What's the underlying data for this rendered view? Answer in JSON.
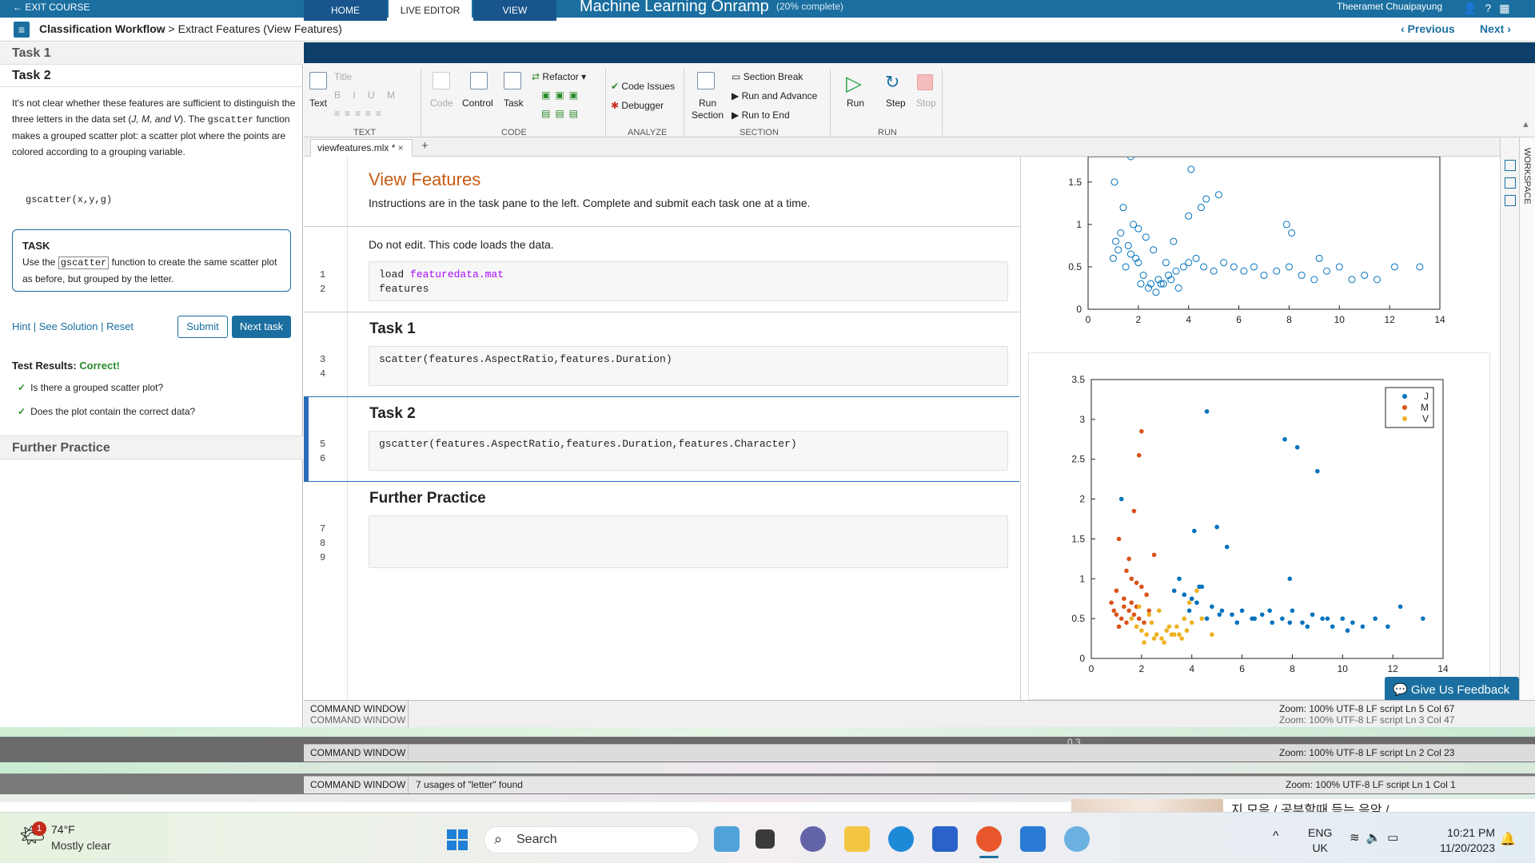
{
  "topbar": {
    "exit": "← EXIT COURSE",
    "title": "Machine Learning Onramp",
    "progress": "(20% complete)",
    "user": "Theeramet Chuaipayung"
  },
  "nav": {
    "breadcrumb_bold": "Classification Workflow",
    "breadcrumb_rest": " > Extract Features (View Features)",
    "previous": "‹ Previous",
    "next": "Next ›"
  },
  "taskpane": {
    "task1": "Task 1",
    "task2": "Task 2",
    "desc1": "It's not clear whether these features are sufficient to distinguish the three letters in the data set (",
    "desc_letters": "J, M, and V",
    "desc2": "). The ",
    "desc_fn": "gscatter",
    "desc3": " function makes a grouped scatter plot: a scatter plot where the points are colored according to a grouping variable.",
    "syntax": "gscatter(x,y,g)",
    "task_label": "TASK",
    "task_text1": "Use the ",
    "task_kw": "gscatter",
    "task_text2": " function to create the same scatter plot as before, but grouped by the letter.",
    "hint": "Hint",
    "see_solution": "See Solution",
    "reset": "Reset",
    "submit": "Submit",
    "next_task": "Next task",
    "test_results_label": "Test Results:",
    "test_results_value": "Correct!",
    "checks": [
      "Is there a grouped scatter plot?",
      "Does the plot contain the correct data?"
    ],
    "further": "Further Practice"
  },
  "ribbon": {
    "tabs": [
      "HOME",
      "LIVE EDITOR",
      "VIEW"
    ],
    "text_btn": "Text",
    "title_btn": "Title",
    "code_btn": "Code",
    "control_btn": "Control",
    "task_btn": "Task",
    "refactor": "Refactor",
    "code_issues": "Code Issues",
    "debugger": "Debugger",
    "run_section": "Run\nSection",
    "section_break": "Section Break",
    "run_advance": "Run and Advance",
    "run_end": "Run to End",
    "run": "Run",
    "step": "Step",
    "stop": "Stop",
    "sections": [
      "TEXT",
      "CODE",
      "ANALYZE",
      "SECTION",
      "RUN"
    ]
  },
  "editor": {
    "tab": "viewfeatures.mlx *",
    "title": "View Features",
    "subtitle": "Instructions are in the task pane to the left. Complete and submit each task one at a time.",
    "noedit": "Do not edit. This code loads the data.",
    "code_load_kw": "load ",
    "code_load_str": "featuredata.mat",
    "code_features": "features",
    "task1": "Task 1",
    "code_task1": "scatter(features.AspectRatio,features.Duration)",
    "task2": "Task 2",
    "code_task2": "gscatter(features.AspectRatio,features.Duration,features.Character)",
    "further": "Further Practice",
    "line_numbers": [
      "1",
      "2",
      "3",
      "4",
      "5",
      "6",
      "7",
      "8",
      "9"
    ]
  },
  "workspace_label": "WORKSPACE",
  "command": {
    "label": "COMMAND WINDOW",
    "usages": "7 usages of \"letter\" found",
    "status1": "Zoom: 100%   UTF-8   LF   script   Ln  5  Col  67",
    "status2": "Zoom: 100%   UTF-8   LF   script   Ln  3  Col  47",
    "status3": "Zoom: 100%   UTF-8   LF   script   Ln  2  Col  23",
    "status4": "Zoom: 100%   UTF-8   LF   script   Ln  1  Col  1",
    "glitch_axis": "0.3"
  },
  "feedback": "Give Us Feedback",
  "taskbar": {
    "temp": "74°F",
    "sky": "Mostly clear",
    "badge": "1",
    "search": "Search",
    "lang1": "ENG",
    "lang2": "UK",
    "time": "10:21 PM",
    "date": "11/20/2023",
    "yt_text": "지 모음 / 공부할때 듣는 음악 /..."
  },
  "chart_data": [
    {
      "type": "scatter",
      "xlim": [
        0,
        14
      ],
      "ylim": [
        0,
        1.8
      ],
      "xticks": [
        0,
        2,
        4,
        6,
        8,
        10,
        12,
        14
      ],
      "yticks": [
        0,
        0.5,
        1,
        1.5
      ],
      "marker": "open-circle",
      "color": "#0072bd",
      "series": [
        {
          "x": [
            1.0,
            1.2,
            1.5,
            1.7,
            2.0,
            2.2,
            2.5,
            2.8,
            3.0,
            3.2,
            3.5,
            3.8,
            4.0,
            4.3,
            4.6,
            5.0,
            5.4,
            5.8,
            6.2,
            6.6,
            7.0,
            7.5,
            8.0,
            8.5,
            9.0,
            9.5,
            10.0,
            10.5,
            11.0,
            11.5,
            12.2,
            13.2,
            1.1,
            1.3,
            1.6,
            1.9,
            2.1,
            2.4,
            2.7,
            2.9,
            3.3,
            3.6,
            1.8,
            2.3,
            2.6,
            3.1,
            1.05,
            4.1,
            4.7,
            5.2,
            7.9,
            8.1,
            9.2,
            4.0,
            4.5,
            1.4,
            1.7,
            2.0,
            3.4
          ],
          "y": [
            0.6,
            0.7,
            0.5,
            0.65,
            0.55,
            0.4,
            0.3,
            0.35,
            0.3,
            0.4,
            0.45,
            0.5,
            0.55,
            0.6,
            0.5,
            0.45,
            0.55,
            0.5,
            0.45,
            0.5,
            0.4,
            0.45,
            0.5,
            0.4,
            0.35,
            0.45,
            0.5,
            0.35,
            0.4,
            0.35,
            0.5,
            0.5,
            0.8,
            0.9,
            0.75,
            0.6,
            0.3,
            0.25,
            0.2,
            0.3,
            0.35,
            0.25,
            1.0,
            0.85,
            0.7,
            0.55,
            1.5,
            1.65,
            1.3,
            1.35,
            1.0,
            0.9,
            0.6,
            1.1,
            1.2,
            1.2,
            1.8,
            0.95,
            0.8
          ]
        }
      ]
    },
    {
      "type": "scatter",
      "xlim": [
        0,
        14
      ],
      "ylim": [
        0,
        3.5
      ],
      "xticks": [
        0,
        2,
        4,
        6,
        8,
        10,
        12,
        14
      ],
      "yticks": [
        0,
        0.5,
        1,
        1.5,
        2,
        2.5,
        3,
        3.5
      ],
      "legend_position": "top-right",
      "series": [
        {
          "name": "J",
          "color": "#0072bd",
          "x": [
            4.6,
            7.7,
            8.2,
            9.0,
            1.2,
            4.1,
            5.0,
            5.4,
            3.3,
            3.7,
            4.0,
            4.4,
            4.8,
            5.2,
            5.6,
            6.0,
            6.4,
            6.8,
            7.2,
            7.6,
            8.0,
            8.4,
            8.8,
            9.2,
            9.6,
            10.0,
            10.4,
            10.8,
            11.3,
            11.8,
            12.3,
            13.2,
            3.9,
            4.2,
            4.6,
            5.1,
            5.8,
            6.5,
            7.1,
            7.9,
            8.6,
            9.4,
            10.2,
            7.9,
            3.5,
            4.3
          ],
          "y": [
            3.1,
            2.75,
            2.65,
            2.35,
            2.0,
            1.6,
            1.65,
            1.4,
            0.85,
            0.8,
            0.75,
            0.9,
            0.65,
            0.6,
            0.55,
            0.6,
            0.5,
            0.55,
            0.45,
            0.5,
            0.6,
            0.45,
            0.55,
            0.5,
            0.4,
            0.5,
            0.45,
            0.4,
            0.5,
            0.4,
            0.65,
            0.5,
            0.6,
            0.7,
            0.5,
            0.55,
            0.45,
            0.5,
            0.6,
            0.45,
            0.4,
            0.5,
            0.35,
            1.0,
            1.0,
            0.9
          ]
        },
        {
          "name": "M",
          "color": "#d95319",
          "x": [
            2.0,
            1.9,
            1.7,
            1.1,
            1.5,
            1.4,
            1.6,
            1.8,
            2.0,
            2.2,
            0.8,
            0.9,
            1.0,
            1.2,
            1.3,
            1.5,
            1.7,
            1.9,
            2.1,
            1.0,
            1.3,
            1.6,
            1.8,
            2.3,
            1.1,
            1.4,
            2.5
          ],
          "y": [
            2.85,
            2.55,
            1.85,
            1.5,
            1.25,
            1.1,
            1.0,
            0.95,
            0.9,
            0.8,
            0.7,
            0.6,
            0.55,
            0.5,
            0.65,
            0.6,
            0.55,
            0.5,
            0.45,
            0.85,
            0.75,
            0.7,
            0.65,
            0.6,
            0.4,
            0.45,
            1.3
          ]
        },
        {
          "name": "V",
          "color": "#edb120",
          "x": [
            1.6,
            1.8,
            2.0,
            2.2,
            2.4,
            2.6,
            2.8,
            3.0,
            3.2,
            3.4,
            3.6,
            3.8,
            4.0,
            4.4,
            4.8,
            2.1,
            2.5,
            2.9,
            3.3,
            3.7,
            2.3,
            2.7,
            3.1,
            3.5,
            1.9,
            3.9,
            4.2
          ],
          "y": [
            0.5,
            0.4,
            0.35,
            0.3,
            0.45,
            0.3,
            0.25,
            0.35,
            0.3,
            0.4,
            0.25,
            0.35,
            0.45,
            0.5,
            0.3,
            0.2,
            0.25,
            0.2,
            0.3,
            0.5,
            0.55,
            0.6,
            0.4,
            0.3,
            0.65,
            0.7,
            0.85
          ]
        }
      ]
    }
  ]
}
